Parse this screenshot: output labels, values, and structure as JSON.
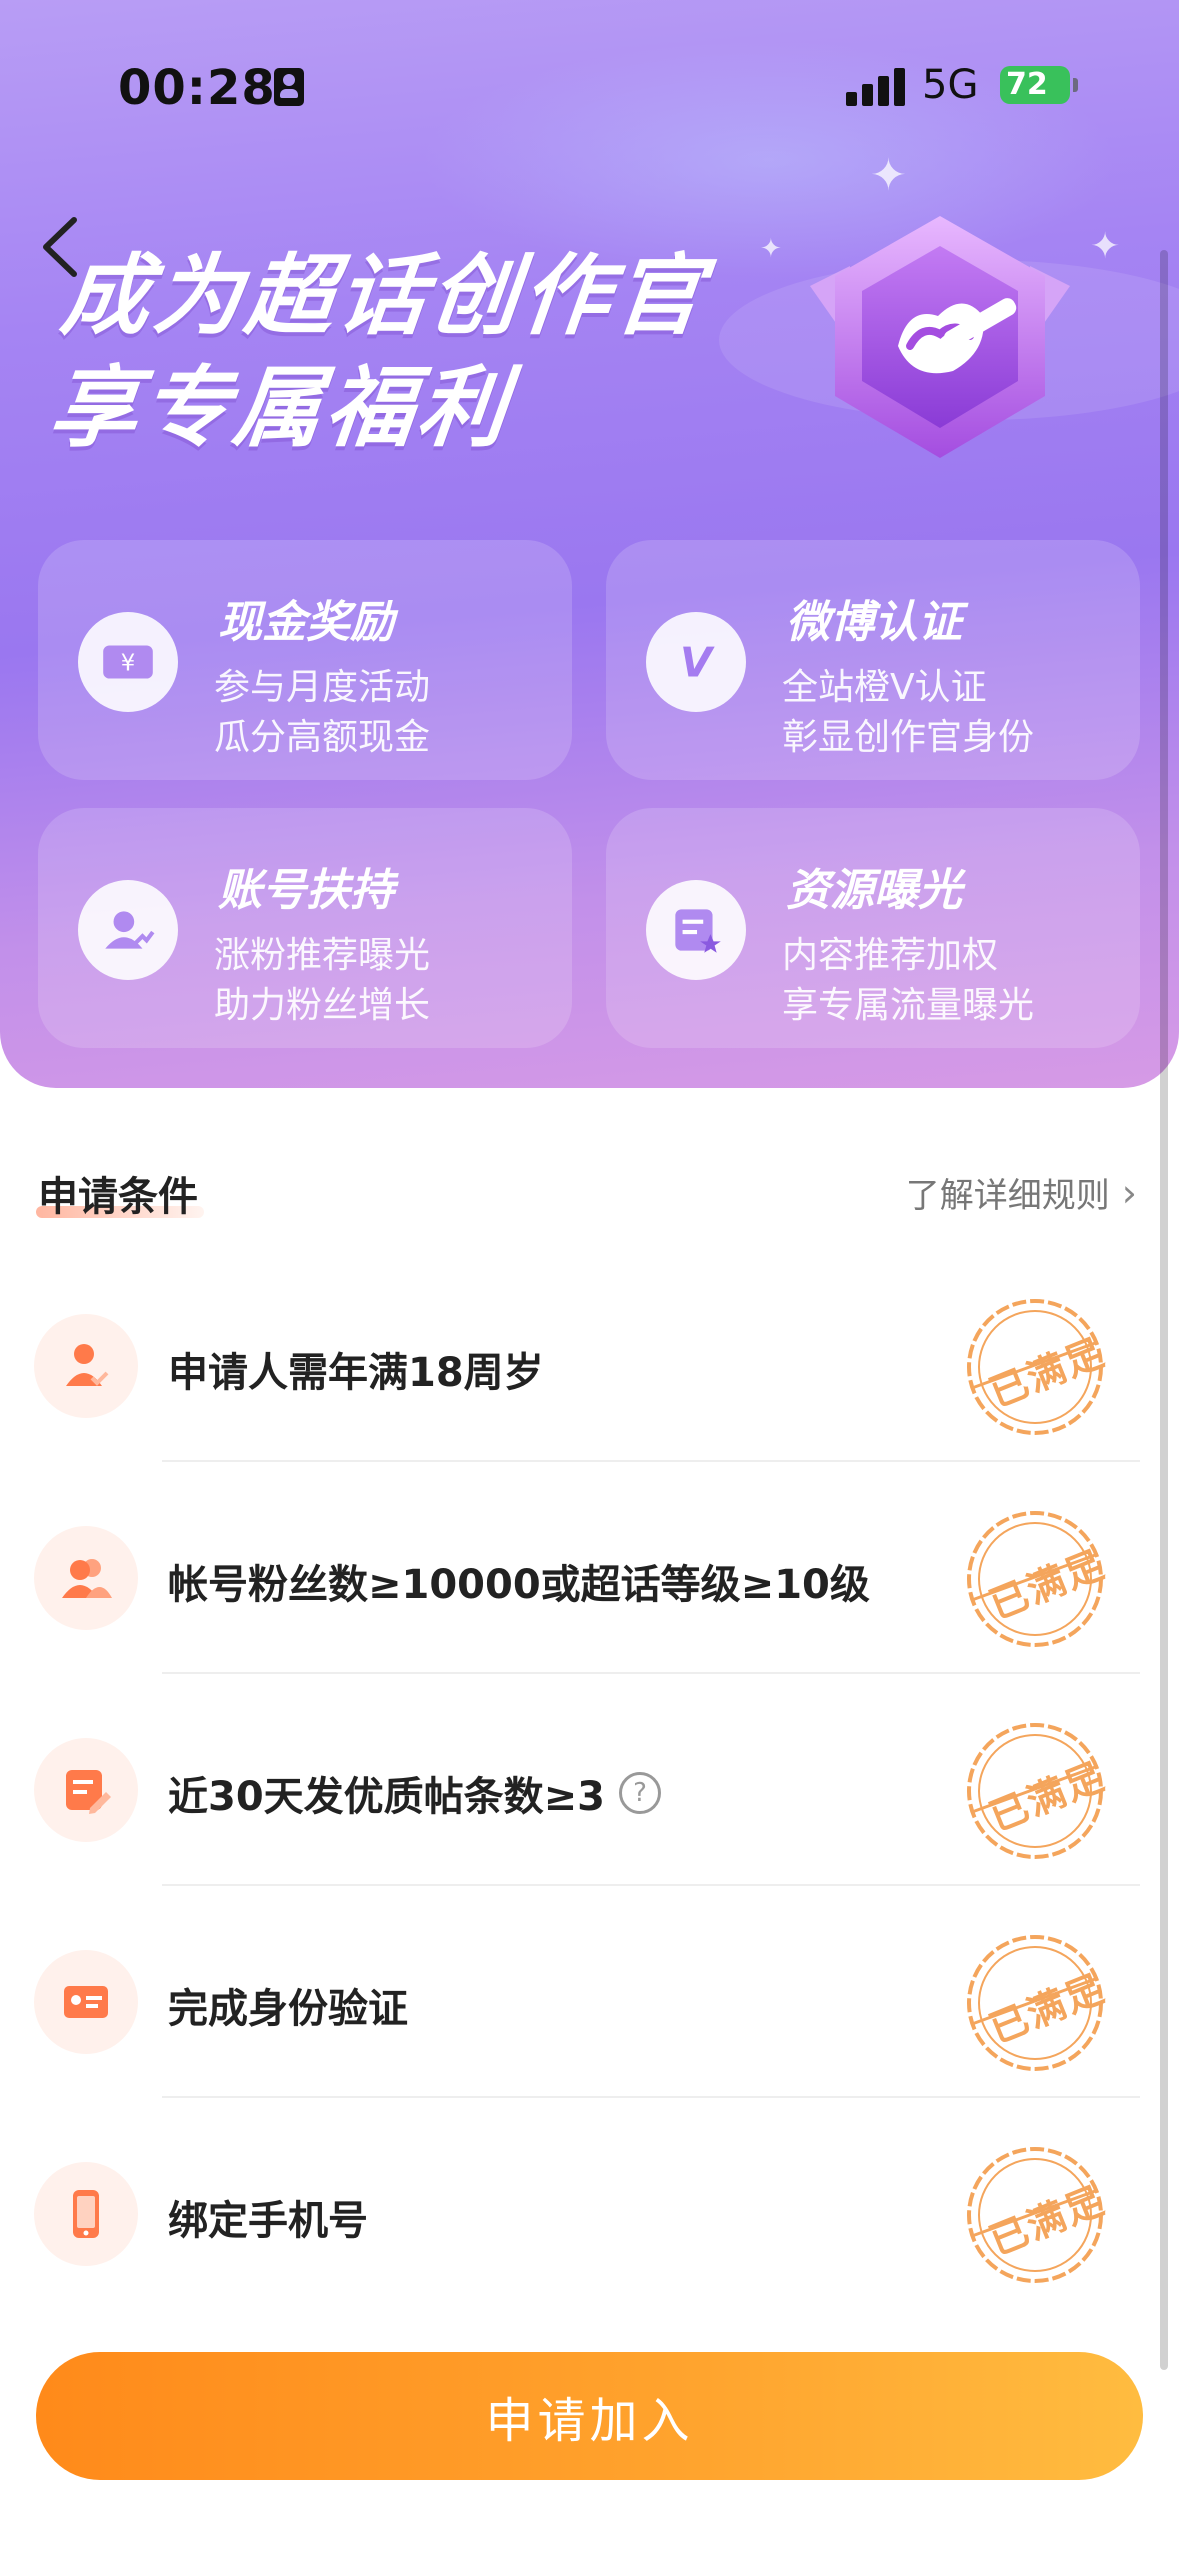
{
  "status_bar": {
    "time": "00:28",
    "network": "5G",
    "battery": "72"
  },
  "hero": {
    "title_line1": "成为超话创作官",
    "title_line2": "享专属福利"
  },
  "benefits": [
    {
      "title": "现金奖励",
      "line1": "参与月度活动",
      "line2": "瓜分高额现金",
      "icon": "cash-ticket-icon"
    },
    {
      "title": "微博认证",
      "line1": "全站橙V认证",
      "line2": "彰显创作官身份",
      "icon": "verified-v-icon"
    },
    {
      "title": "账号扶持",
      "line1": "涨粉推荐曝光",
      "line2": "助力粉丝增长",
      "icon": "user-growth-icon"
    },
    {
      "title": "资源曝光",
      "line1": "内容推荐加权",
      "line2": "享专属流量曝光",
      "icon": "content-star-icon"
    }
  ],
  "conditions": {
    "title": "申请条件",
    "rules_link": "了解详细规则",
    "items": [
      {
        "text": "申请人需年满18周岁",
        "status": "已满足",
        "icon": "person-check-icon",
        "help": false
      },
      {
        "text": "帐号粉丝数≥10000或超话等级≥10级",
        "status": "已满足",
        "icon": "users-icon",
        "help": false
      },
      {
        "text": "近30天发优质帖条数≥3",
        "status": "已满足",
        "icon": "edit-post-icon",
        "help": true,
        "help_symbol": "?"
      },
      {
        "text": "完成身份验证",
        "status": "已满足",
        "icon": "id-card-icon",
        "help": false
      },
      {
        "text": "绑定手机号",
        "status": "已满足",
        "icon": "phone-icon",
        "help": false
      }
    ]
  },
  "apply_button": {
    "label": "申请加入"
  },
  "colors": {
    "accent": "#ff8a1a",
    "stamp": "#f4a55c",
    "hero": "#a584f3"
  }
}
